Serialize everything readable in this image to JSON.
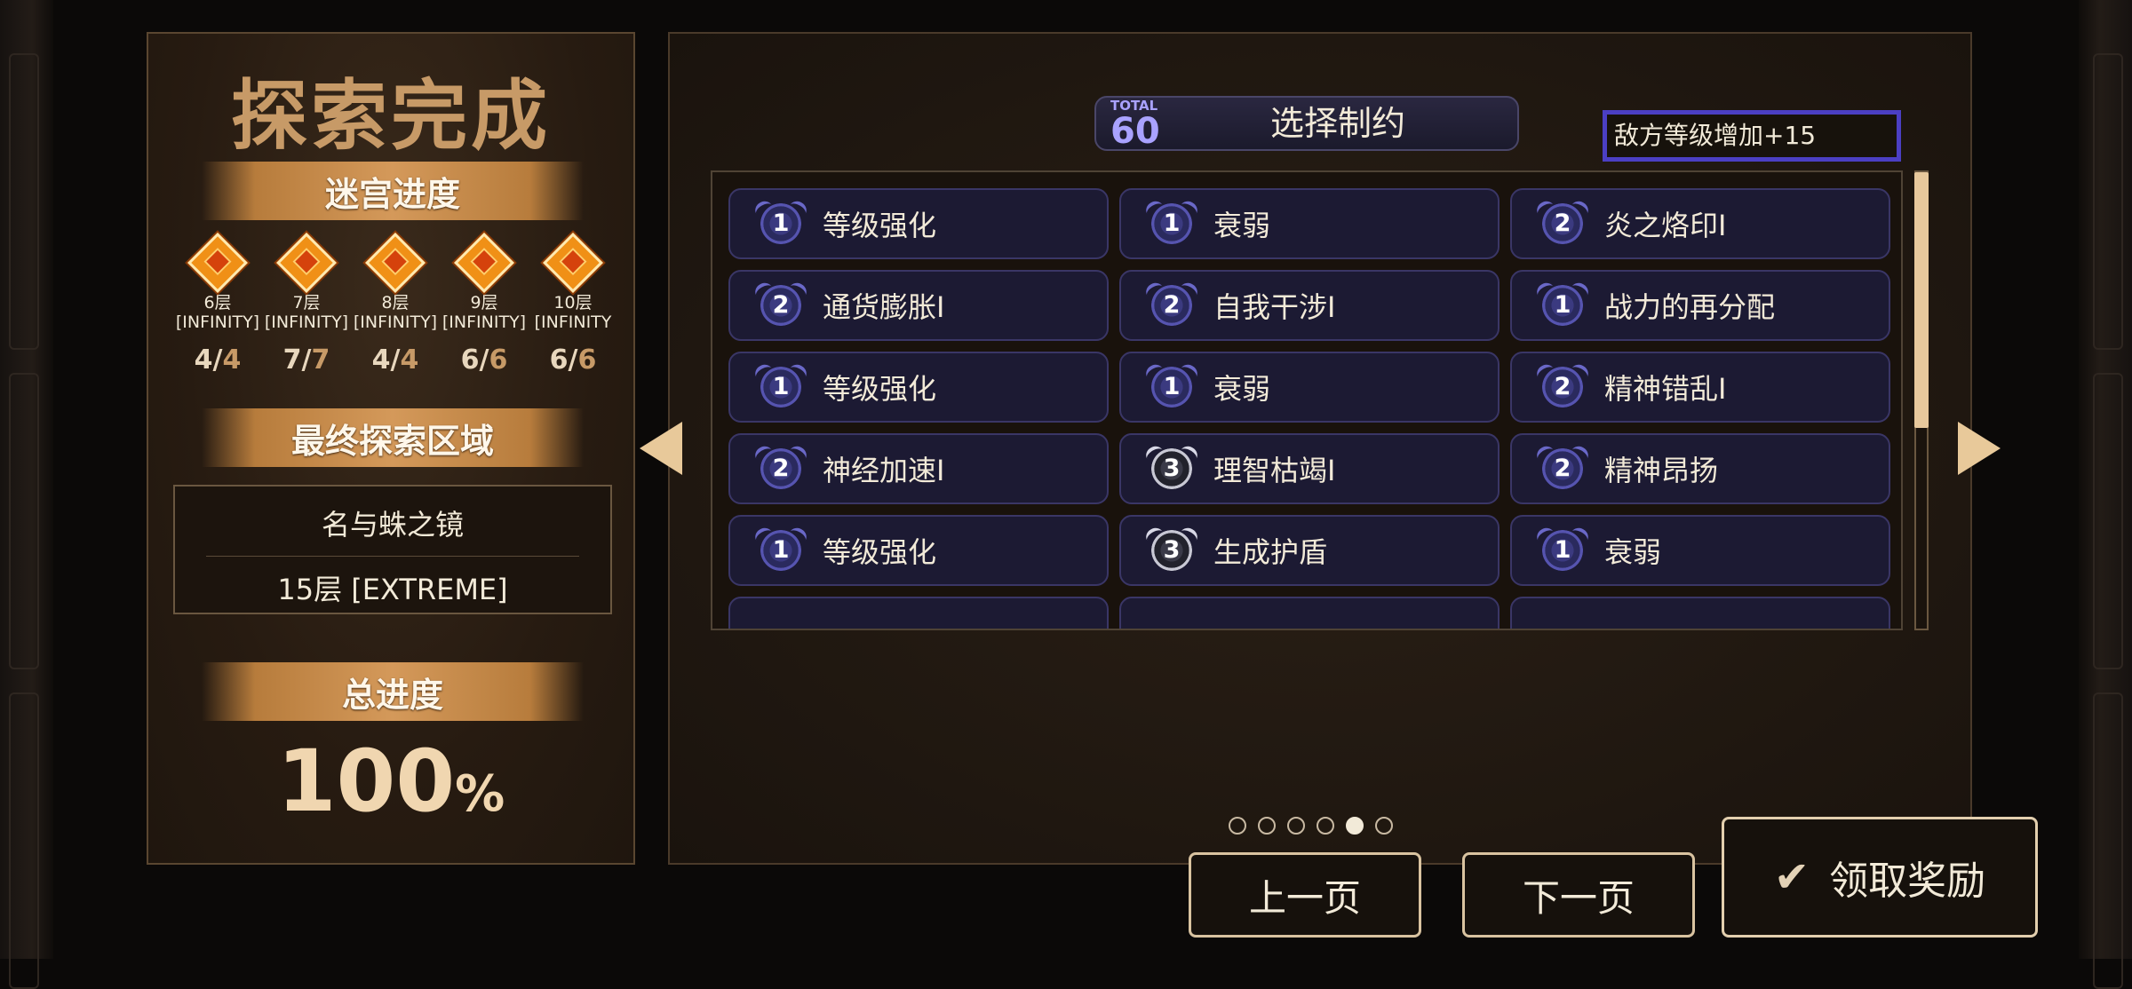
{
  "left_panel": {
    "title": "探索完成",
    "maze_progress_title": "迷宫进度",
    "floors": [
      {
        "name": "6层",
        "mode": "[INFINITY]",
        "done": "4",
        "total": "4"
      },
      {
        "name": "7层",
        "mode": "[INFINITY]",
        "done": "7",
        "total": "7"
      },
      {
        "name": "8层",
        "mode": "[INFINITY]",
        "done": "4",
        "total": "4"
      },
      {
        "name": "9层",
        "mode": "[INFINITY]",
        "done": "6",
        "total": "6"
      },
      {
        "name": "10层",
        "mode": "[INFINITY",
        "done": "6",
        "total": "6"
      }
    ],
    "final_area_title": "最终探索区域",
    "final_area_name": "名与蛛之镜",
    "final_area_floor": "15层 [EXTREME]",
    "total_progress_title": "总进度",
    "total_progress_value": "100",
    "total_progress_unit": "%"
  },
  "main_panel": {
    "total_label": "TOTAL",
    "total_value": "60",
    "title": "选择制约",
    "effect_text": "敌方等级增加+15",
    "constraints": [
      {
        "level": "1",
        "label": "等级强化"
      },
      {
        "level": "1",
        "label": "衰弱"
      },
      {
        "level": "2",
        "label": "炎之烙印Ⅰ"
      },
      {
        "level": "2",
        "label": "通货膨胀Ⅰ"
      },
      {
        "level": "2",
        "label": "自我干涉Ⅰ"
      },
      {
        "level": "1",
        "label": "战力的再分配"
      },
      {
        "level": "1",
        "label": "等级强化"
      },
      {
        "level": "1",
        "label": "衰弱"
      },
      {
        "level": "2",
        "label": "精神错乱Ⅰ"
      },
      {
        "level": "2",
        "label": "神经加速Ⅰ"
      },
      {
        "level": "3",
        "label": "理智枯竭Ⅰ"
      },
      {
        "level": "2",
        "label": "精神昂扬"
      },
      {
        "level": "1",
        "label": "等级强化"
      },
      {
        "level": "3",
        "label": "生成护盾"
      },
      {
        "level": "1",
        "label": "衰弱"
      }
    ],
    "page_dots": 6,
    "current_page": 5,
    "scroll_position": 0.0
  },
  "buttons": {
    "prev": "上一页",
    "next": "下一页",
    "claim": "领取奖励"
  },
  "colors": {
    "accent_gold": "#c79a67",
    "accent_purple": "#4b3fc3",
    "panel_bg": "#271b11"
  }
}
